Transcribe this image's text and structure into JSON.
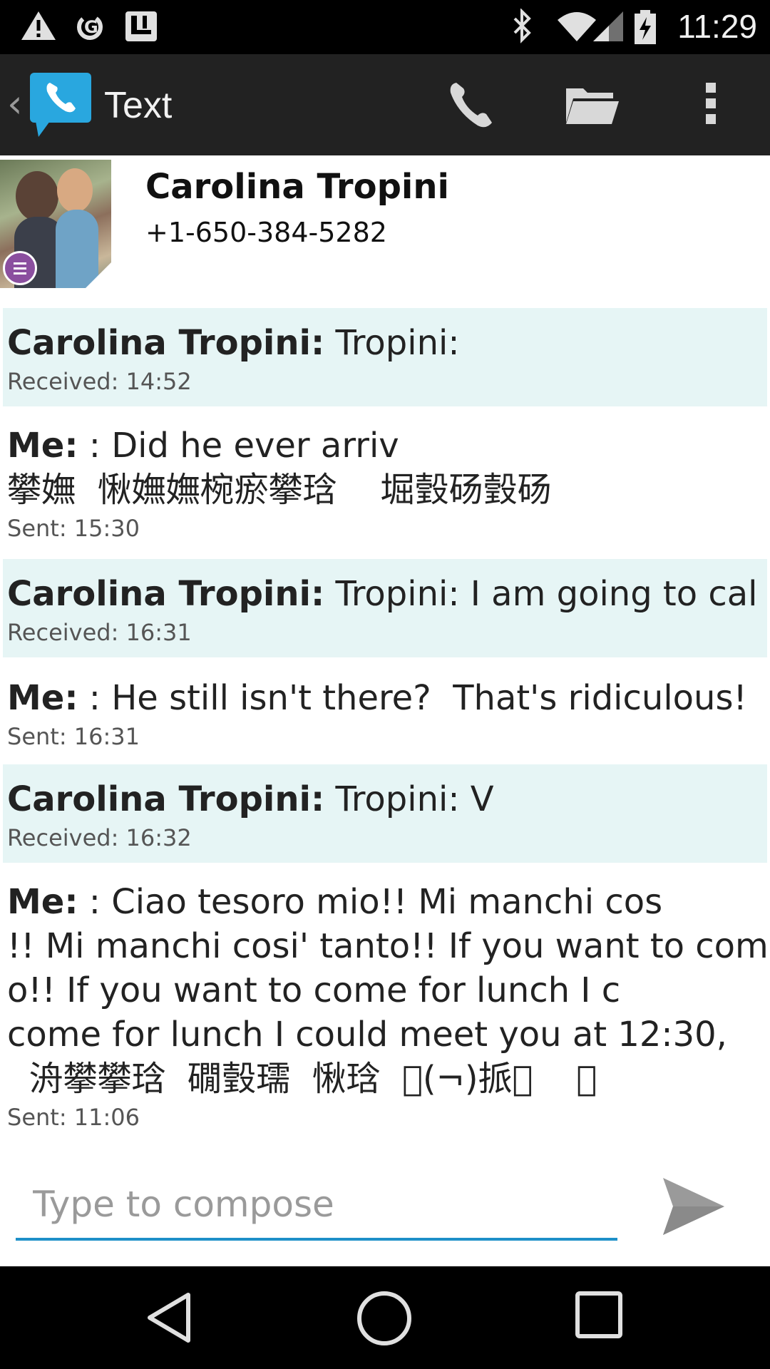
{
  "status_bar": {
    "time": "11:29",
    "icons": [
      "warning-icon",
      "sync-icon",
      "notification-icon",
      "bluetooth-icon",
      "wifi-icon",
      "signal-icon",
      "battery-charging-icon"
    ]
  },
  "app_bar": {
    "title": "Text",
    "actions": [
      "phone-icon",
      "folder-icon",
      "overflow-menu-icon"
    ]
  },
  "contact": {
    "name": "Carolina Tropini",
    "phone": "+1-650-384-5282"
  },
  "messages": [
    {
      "type": "received",
      "sender": "Carolina Tropini:",
      "lines": [
        " Tropini:"
      ],
      "time": "Received: 14:52"
    },
    {
      "type": "sent",
      "sender": "Me:",
      "lines": [
        " : Did he ever arriv",
        "攀嫵  愀嫵嫵椀瘀攀琀    堀瑴砀瑴砀"
      ],
      "time": "Sent: 15:30"
    },
    {
      "type": "received",
      "sender": "Carolina Tropini:",
      "lines": [
        " Tropini: I am going to cal"
      ],
      "time": "Received: 16:31"
    },
    {
      "type": "sent",
      "sender": "Me:",
      "lines": [
        " : He still isn't there?  That's ridiculous!"
      ],
      "time": "Sent: 16:31"
    },
    {
      "type": "received",
      "sender": "Carolina Tropini:",
      "lines": [
        " Tropini: V"
      ],
      "time": "Received: 16:32"
    },
    {
      "type": "sent",
      "sender": "Me:",
      "lines": [
        " : Ciao tesoro mio!! Mi manchi cos",
        "!! Mi manchi cosi' tanto!! If you want to com",
        "o!! If you want to come for lunch I c",
        "come for lunch I could meet you at 12:30,",
        "  洀攀攀琀  礀瑴瓀  愀琀  \u0000(¬)挀\u0000    \u0000"
      ],
      "time": "Sent: 11:06"
    }
  ],
  "compose": {
    "placeholder": "Type to compose"
  },
  "colors": {
    "received_bg": "#e6f5f5",
    "accent": "#1e90c8",
    "app_bar": "#222222"
  }
}
